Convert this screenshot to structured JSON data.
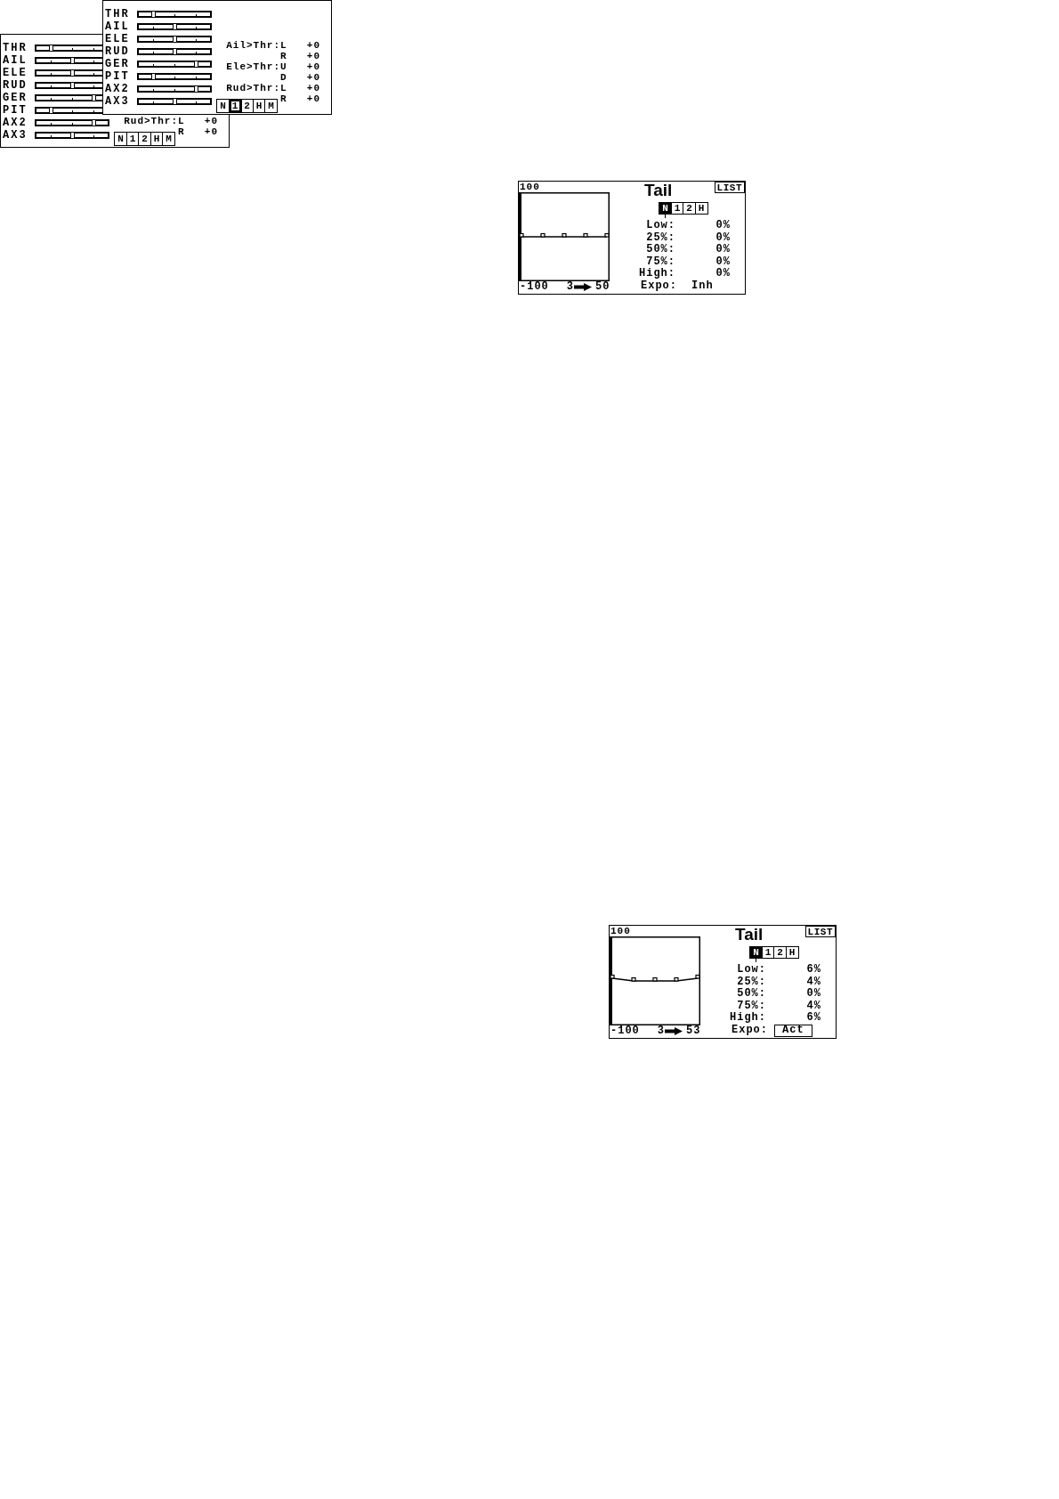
{
  "mix_screens": [
    {
      "channels": [
        {
          "label": "THR",
          "level": 0.2
        },
        {
          "label": "AIL",
          "level": 0.5
        },
        {
          "label": "ELE",
          "level": 0.5
        },
        {
          "label": "RUD",
          "level": 0.5
        },
        {
          "label": "GER",
          "level": 0.8
        },
        {
          "label": "PIT",
          "level": 0.2
        },
        {
          "label": "AX2",
          "level": 0.8
        },
        {
          "label": "AX3",
          "level": 0.5
        }
      ],
      "mixes": [
        {
          "label": "Ail>Thr:",
          "side": "L",
          "value": "+0"
        },
        {
          "side": "R",
          "value": "+0"
        },
        {
          "label": "Ele>Thr:",
          "side": "U",
          "value": "+0"
        },
        {
          "side": "D",
          "value": "+0"
        },
        {
          "label": "Rud>Thr:",
          "side": "L",
          "value": "+0"
        },
        {
          "side": "R",
          "value": "+0"
        }
      ],
      "modes": [
        {
          "label": "N",
          "selected": false
        },
        {
          "label": "1",
          "selected": true
        },
        {
          "label": "2",
          "selected": false
        },
        {
          "label": "H",
          "selected": false
        },
        {
          "label": "M",
          "selected": false
        }
      ]
    },
    {
      "channels": [
        {
          "label": "THR",
          "level": 0.2
        },
        {
          "label": "AIL",
          "level": 0.5
        },
        {
          "label": "ELE",
          "level": 0.5
        },
        {
          "label": "RUD",
          "level": 0.5
        },
        {
          "label": "GER",
          "level": 0.8
        },
        {
          "label": "PIT",
          "level": 0.2
        },
        {
          "label": "AX2",
          "level": 0.8
        },
        {
          "label": "AX3",
          "level": 0.5
        }
      ],
      "mixes": [
        {
          "label": "Rud>Thr:",
          "side": "L",
          "value": "+0"
        },
        {
          "side": "R",
          "value": "+0"
        }
      ],
      "modes": [
        {
          "label": "N",
          "selected": false
        },
        {
          "label": "1",
          "selected": false
        },
        {
          "label": "2",
          "selected": false
        },
        {
          "label": "H",
          "selected": false
        },
        {
          "label": "M",
          "selected": false
        }
      ]
    }
  ],
  "tail_screens": [
    {
      "title": "Tail",
      "list_button": "LIST",
      "modes": [
        {
          "label": "N",
          "selected": true
        },
        {
          "label": "1",
          "selected": false
        },
        {
          "label": "2",
          "selected": false
        },
        {
          "label": "H",
          "selected": false
        }
      ],
      "graph": {
        "top_label": "100",
        "bottom_label": "-100"
      },
      "readout": {
        "input": "3",
        "output": "50"
      },
      "points": [
        {
          "label": "Low:",
          "value": "0%"
        },
        {
          "label": "25%:",
          "value": "0%"
        },
        {
          "label": "50%:",
          "value": "0%"
        },
        {
          "label": "75%:",
          "value": "0%"
        },
        {
          "label": "High:",
          "value": "0%"
        }
      ],
      "expo": {
        "label": "Expo:",
        "value": "Inh",
        "focused": false
      }
    },
    {
      "title": "Tail",
      "list_button": "LIST",
      "modes": [
        {
          "label": "N",
          "selected": true
        },
        {
          "label": "1",
          "selected": false
        },
        {
          "label": "2",
          "selected": false
        },
        {
          "label": "H",
          "selected": false
        }
      ],
      "graph": {
        "top_label": "100",
        "bottom_label": "-100"
      },
      "readout": {
        "input": "3",
        "output": "53"
      },
      "points": [
        {
          "label": "Low:",
          "value": "6%"
        },
        {
          "label": "25%:",
          "value": "4%"
        },
        {
          "label": "50%:",
          "value": "0%"
        },
        {
          "label": "75%:",
          "value": "4%"
        },
        {
          "label": "High:",
          "value": "6%"
        }
      ],
      "expo": {
        "label": "Expo:",
        "value": "Act",
        "focused": true
      }
    }
  ]
}
